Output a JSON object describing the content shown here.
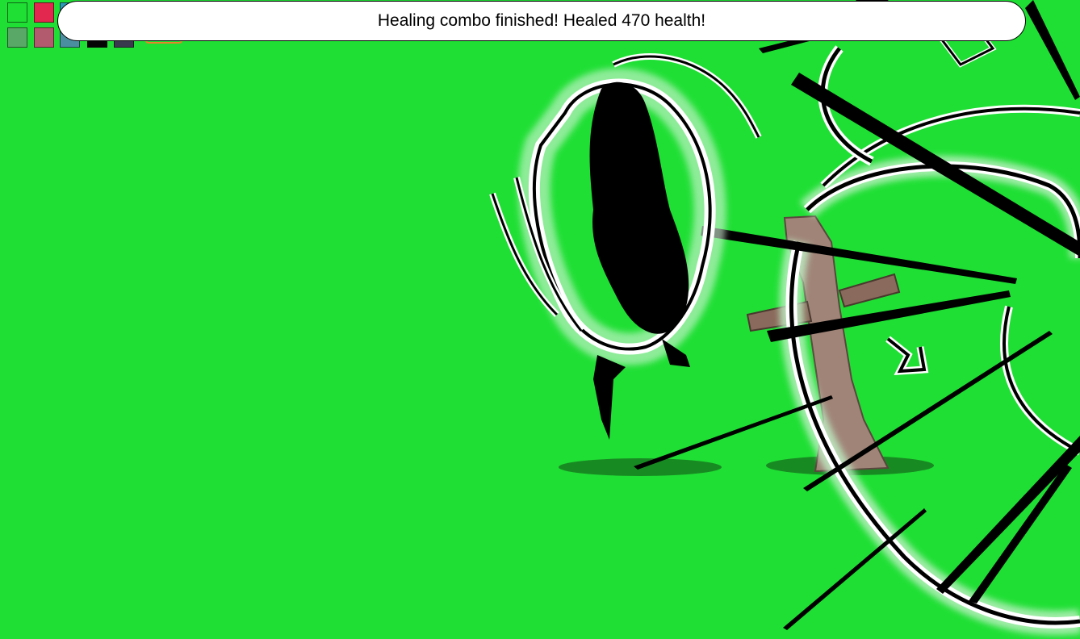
{
  "hud": {
    "message": "Healing combo finished! Healed 470 health!",
    "swatches_row1": [
      {
        "name": "green-swatch",
        "color": "#1fdf34"
      },
      {
        "name": "red-swatch",
        "color": "#e2284e"
      },
      {
        "name": "teal-swatch",
        "color": "#2a9bb4"
      }
    ],
    "swatches_row2": [
      {
        "name": "dark-green-swatch",
        "color": "#5aa868"
      },
      {
        "name": "dusty-rose-swatch",
        "color": "#b25a6e"
      },
      {
        "name": "steel-blue-swatch",
        "color": "#4a8fa0"
      },
      {
        "name": "black-swatch",
        "color": "#050505"
      },
      {
        "name": "slate-swatch",
        "color": "#3a3a4e"
      }
    ],
    "accent_button_color": "#e8842a"
  },
  "scene": {
    "background_color": "#1fdf34",
    "shadow_color": "#188a22",
    "effect": "lightning-healing-aura"
  }
}
